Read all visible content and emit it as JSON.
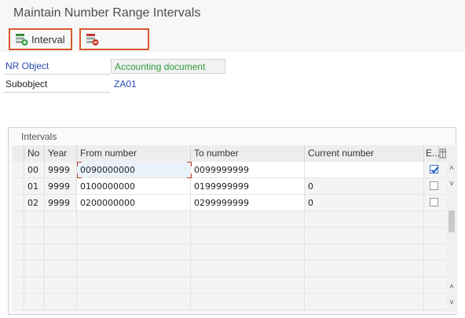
{
  "window": {
    "title": "Maintain Number Range Intervals"
  },
  "toolbar": {
    "interval_label": "Interval",
    "delete_icon": "delete-interval-icon",
    "insert_icon": "insert-interval-icon"
  },
  "header": {
    "nr_object_label": "NR Object",
    "nr_object_value": "Accounting document",
    "subobject_label": "Subobject",
    "subobject_value": "ZA01"
  },
  "intervals": {
    "title": "Intervals",
    "columns": [
      "No",
      "Year",
      "From number",
      "To number",
      "Current number",
      "E..."
    ],
    "rows": [
      {
        "no": "00",
        "year": "9999",
        "from": "0090000000",
        "to": "0099999999",
        "current": "",
        "ext": true
      },
      {
        "no": "01",
        "year": "9999",
        "from": "0100000000",
        "to": "0199999999",
        "current": "0",
        "ext": false
      },
      {
        "no": "02",
        "year": "9999",
        "from": "0200000000",
        "to": "0299999999",
        "current": "0",
        "ext": false
      }
    ]
  },
  "colors": {
    "accent_border": "#d9572a",
    "link_blue": "#2a4bb0",
    "readonly_green": "#2e9b3e"
  }
}
